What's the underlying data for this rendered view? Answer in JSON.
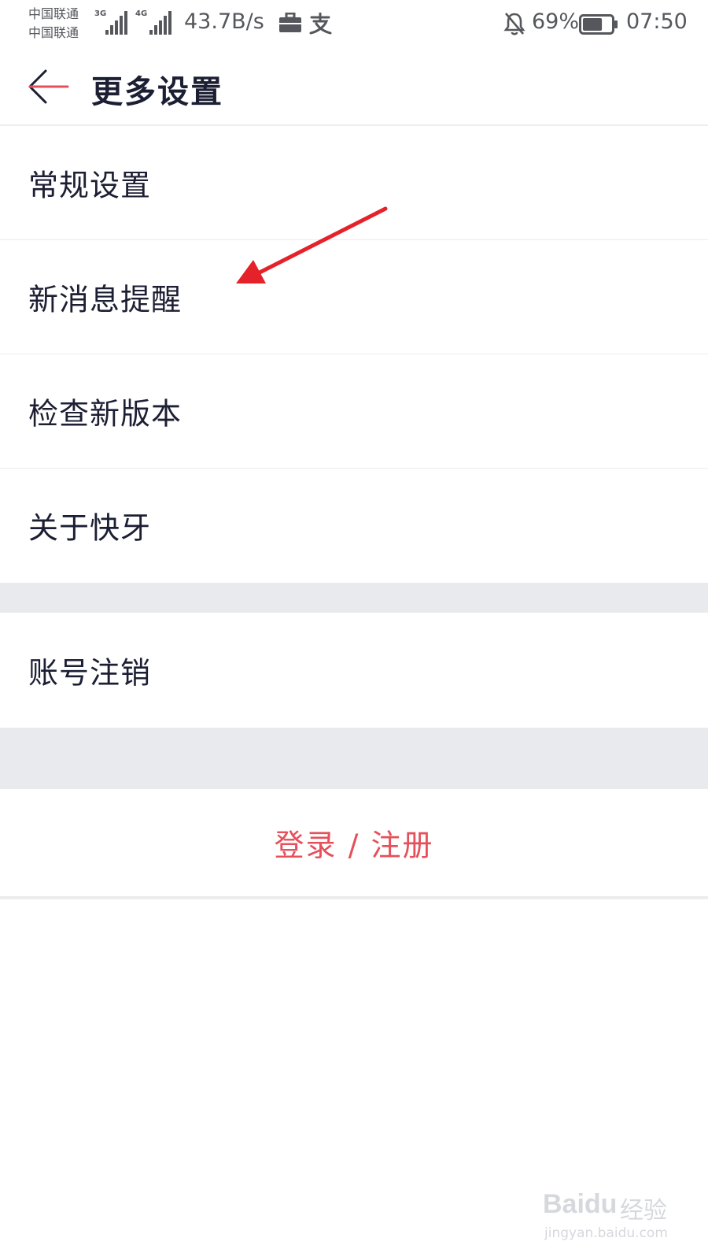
{
  "status_bar": {
    "carrier_1": "中国联通",
    "carrier_2": "中国联通",
    "network_1": "3G",
    "network_2": "4G",
    "net_speed": "43.7B/s",
    "battery_percent": "69%",
    "battery_level": 0.69,
    "time": "07:50",
    "icons": [
      "signal-3g-icon",
      "signal-4g-icon",
      "briefcase-icon",
      "alipay-icon",
      "bell-muted-icon",
      "battery-icon"
    ]
  },
  "header": {
    "back_icon": "back-arrow-icon",
    "title": "更多设置"
  },
  "menu": {
    "items": [
      {
        "label": "常规设置"
      },
      {
        "label": "新消息提醒"
      },
      {
        "label": "检查新版本"
      },
      {
        "label": "关于快牙"
      }
    ],
    "account_item": {
      "label": "账号注销"
    },
    "login_label": "登录 / 注册"
  },
  "annotation": {
    "icon": "red-arrow-annotation",
    "color": "#e5212a"
  },
  "watermark": {
    "logo": "Baidu",
    "brand": "经验",
    "url": "jingyan.baidu.com"
  },
  "colors": {
    "accent": "#e5505a",
    "text_primary": "#1c1f33",
    "separator": "#e9eaee"
  }
}
